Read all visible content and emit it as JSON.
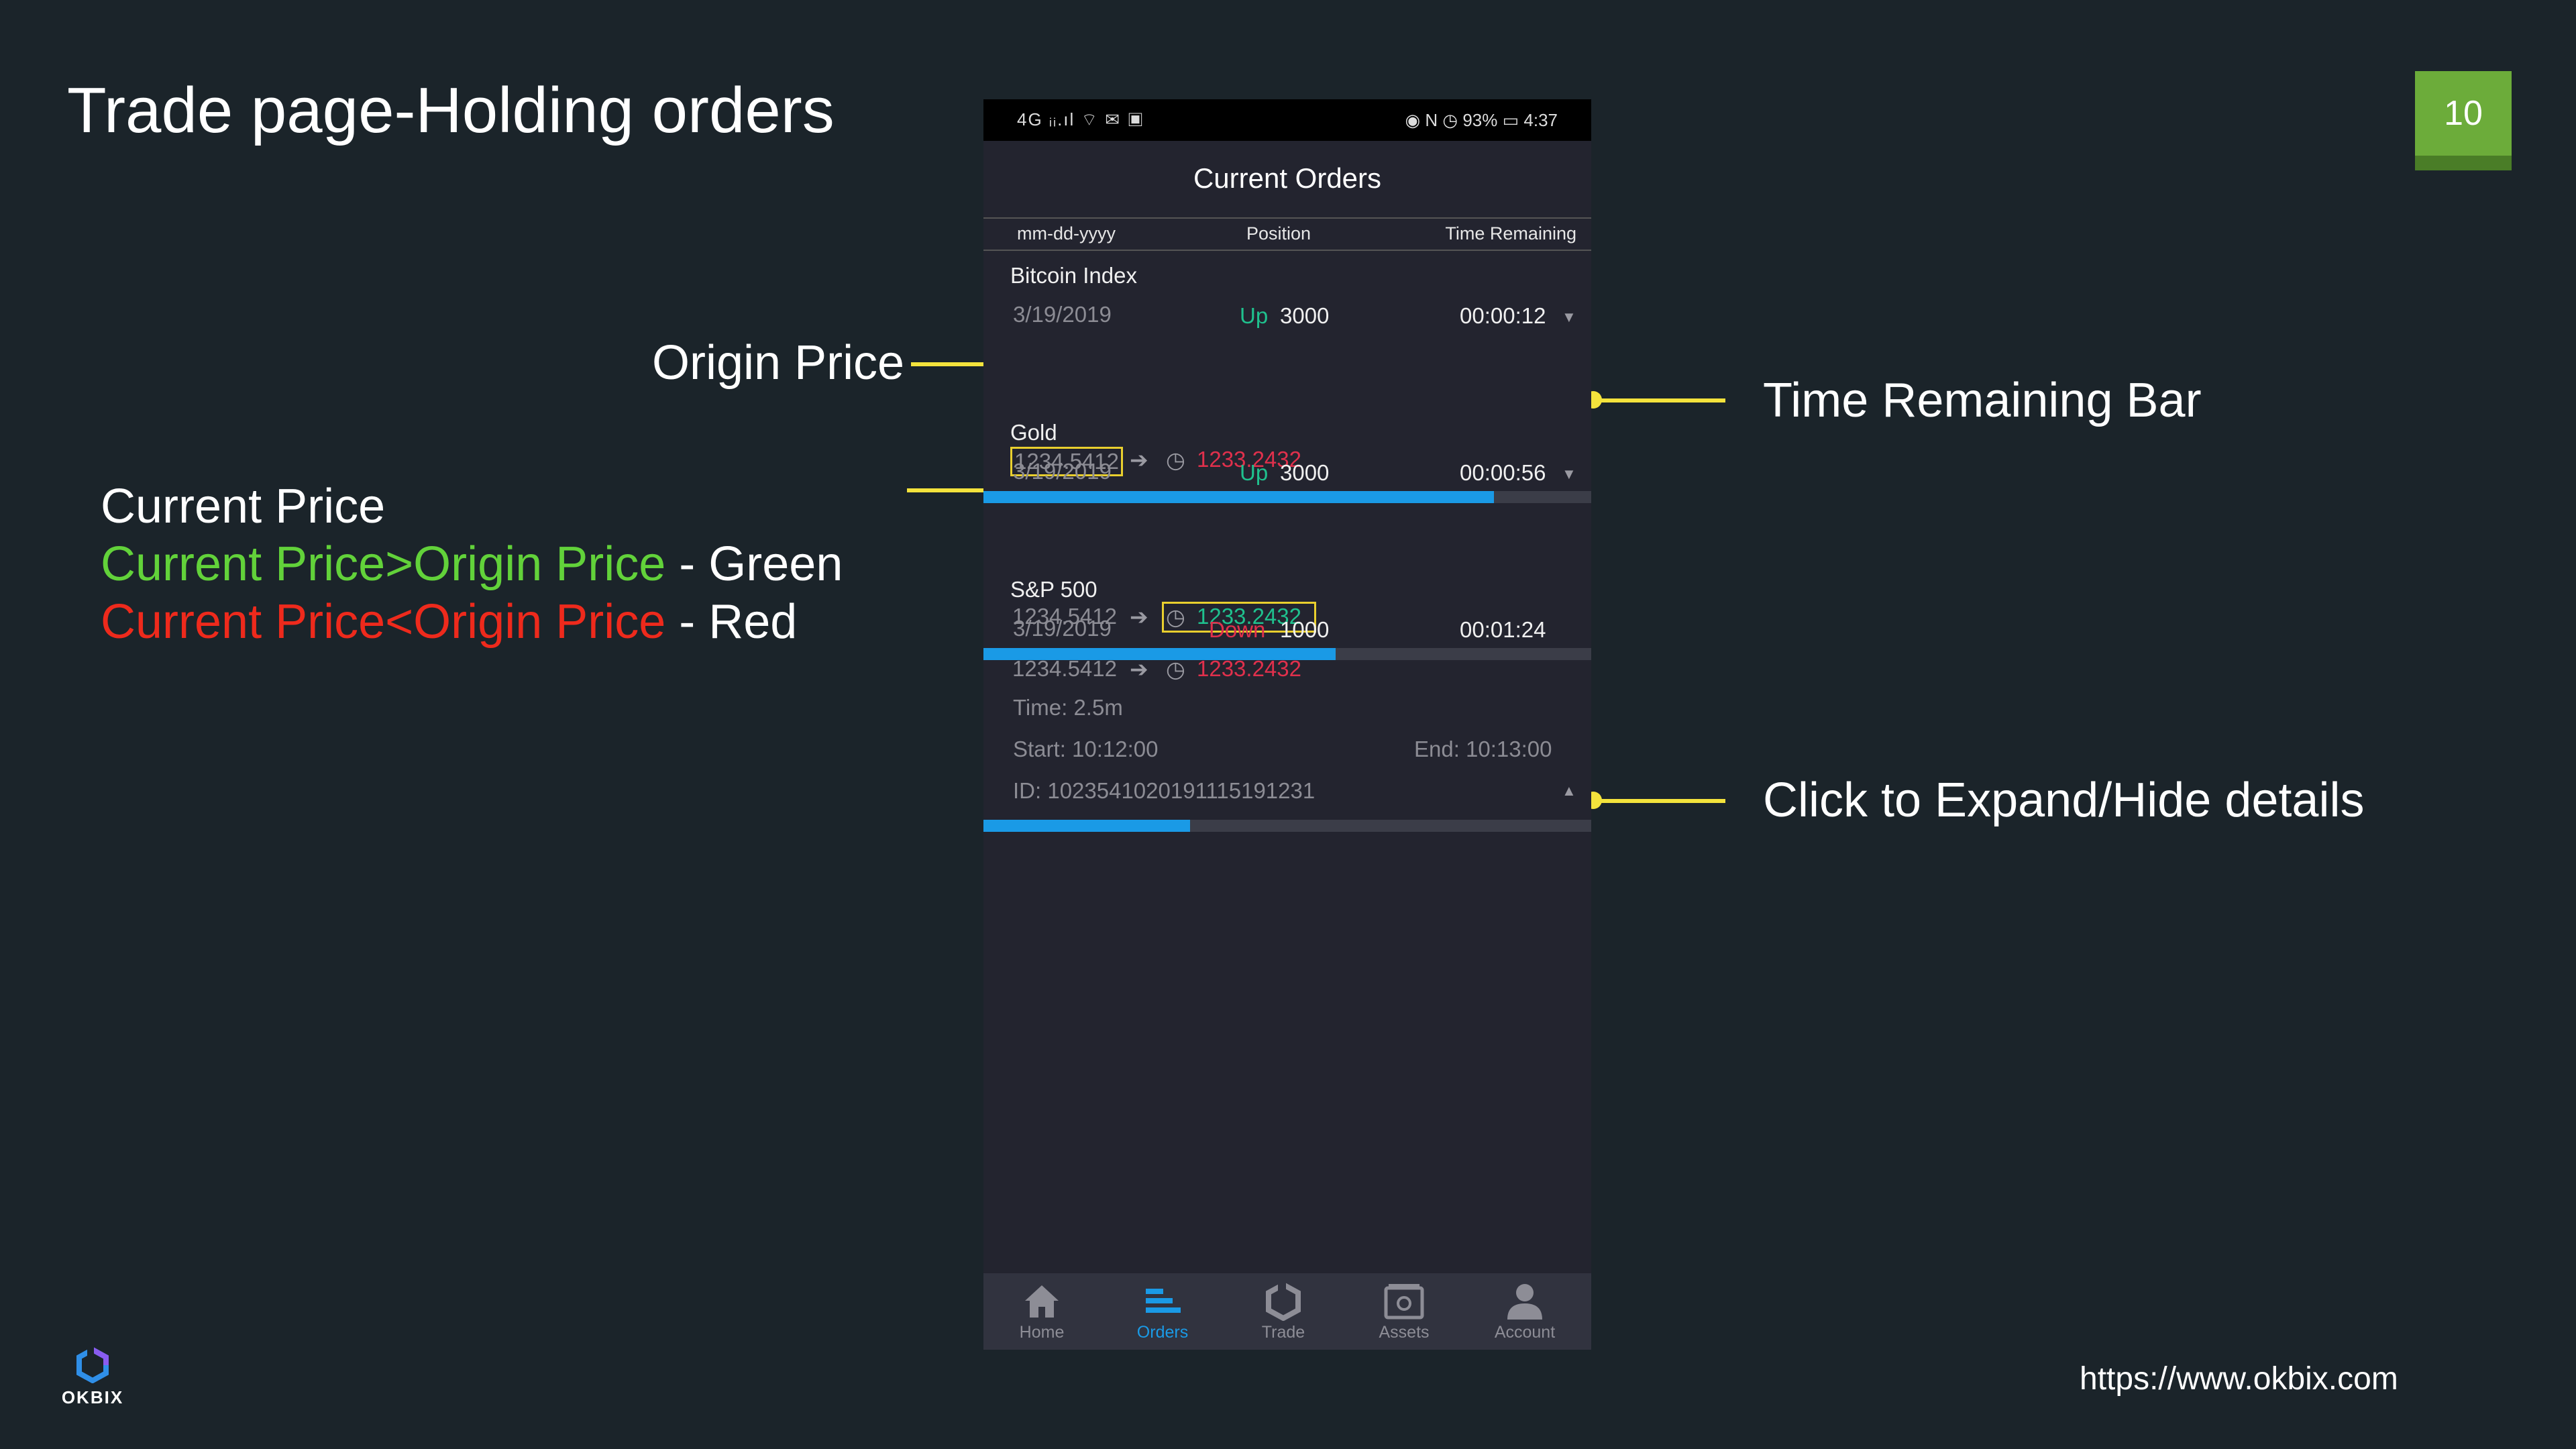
{
  "slide": {
    "title": "Trade page-Holding orders",
    "page_number": "10",
    "url": "https://www.okbix.com",
    "logo_text": "OKBIX"
  },
  "annotations": {
    "origin_price": "Origin Price",
    "time_remaining_bar": "Time Remaining Bar",
    "expand_hide": "Click to Expand/Hide details",
    "current_price": "Current Price",
    "green_rule_colored": "Current Price>Origin Price",
    "green_rule_suffix": " - Green",
    "red_rule_colored": "Current Price<Origin Price",
    "red_rule_suffix": " - Red"
  },
  "colors": {
    "background": "#1b242a",
    "accent_yellow": "#f4e33c",
    "page_badge": "#6cac3a",
    "up_green": "#1fc18e",
    "down_red": "#e0304c",
    "progress_blue": "#1a9ae6"
  },
  "phone": {
    "status_left": "4G  ᵢᵢ.ıl  ⌔  ✉ ▣",
    "status_right": "◉ N ◷ 93% ▭ 4:37",
    "screen_title": "Current Orders",
    "columns": [
      "mm-dd-yyyy",
      "Position",
      "Time Remaining"
    ],
    "orders": [
      {
        "name": "Bitcoin Index",
        "date": "3/19/2019",
        "direction": "Up",
        "amount": "3000",
        "time_remaining": "00:00:12",
        "origin_price": "1234.5412",
        "current_price": "1233.2432",
        "progress": 0.84,
        "expanded": false
      },
      {
        "name": "Gold",
        "date": "3/19/2019",
        "direction": "Up",
        "amount": "3000",
        "time_remaining": "00:00:56",
        "origin_price": "1234.5412",
        "current_price": "1233.2432",
        "progress": 0.58,
        "expanded": false
      },
      {
        "name": "S&P 500",
        "date": "3/19/2019",
        "direction": "Down",
        "amount": "1000",
        "time_remaining": "00:01:24",
        "origin_price": "1234.5412",
        "current_price": "1233.2432",
        "progress": 0.34,
        "expanded": true,
        "details": {
          "time": "Time: 2.5m",
          "start": "Start: 10:12:00",
          "end": "End: 10:13:00",
          "id": "ID: 1023541020191115191231"
        }
      }
    ],
    "tabs": [
      {
        "label": "Home",
        "icon": "home-icon",
        "active": false
      },
      {
        "label": "Orders",
        "icon": "orders-icon",
        "active": true
      },
      {
        "label": "Trade",
        "icon": "trade-icon",
        "active": false
      },
      {
        "label": "Assets",
        "icon": "wallet-icon",
        "active": false
      },
      {
        "label": "Account",
        "icon": "account-icon",
        "active": false
      }
    ]
  }
}
